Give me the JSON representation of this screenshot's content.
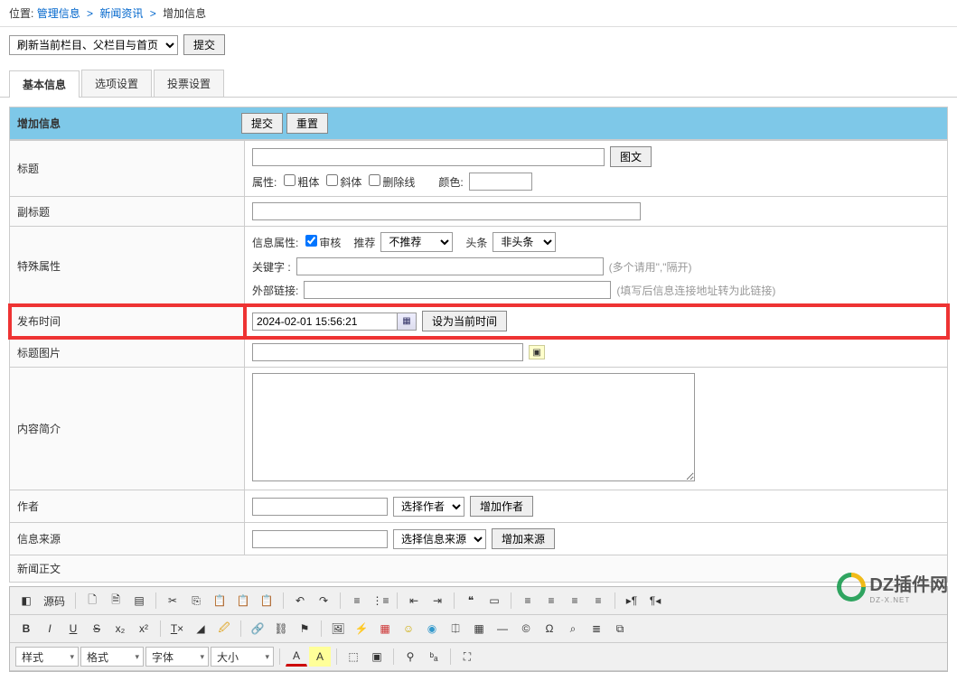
{
  "breadcrumb": {
    "label": "位置:",
    "items": [
      "管理信息",
      "新闻资讯",
      "增加信息"
    ]
  },
  "toolbar": {
    "refresh_select": "刷新当前栏目、父栏目与首页",
    "submit": "提交"
  },
  "tabs": [
    "基本信息",
    "选项设置",
    "投票设置"
  ],
  "panel": {
    "title": "增加信息",
    "submit": "提交",
    "reset": "重置"
  },
  "form": {
    "title": {
      "label": "标题",
      "imgtext_btn": "图文",
      "attr_label": "属性:",
      "bold": "粗体",
      "italic": "斜体",
      "strike": "删除线",
      "color_label": "颜色:"
    },
    "subtitle": {
      "label": "副标题"
    },
    "special": {
      "label": "特殊属性",
      "infoattr_label": "信息属性:",
      "audit": "审核",
      "recommend_label": "推荐",
      "recommend_select": "不推荐",
      "headline_label": "头条",
      "headline_select": "非头条",
      "keyword_label": "关键字 :",
      "keyword_hint": "(多个请用\",\"隔开)",
      "extlink_label": "外部链接:",
      "extlink_hint": "(填写后信息连接地址转为此链接)"
    },
    "pubtime": {
      "label": "发布时间",
      "value": "2024-02-01 15:56:21",
      "now_btn": "设为当前时间"
    },
    "titlepic": {
      "label": "标题图片"
    },
    "intro": {
      "label": "内容简介"
    },
    "author": {
      "label": "作者",
      "select": "选择作者",
      "add_btn": "增加作者"
    },
    "source": {
      "label": "信息来源",
      "select": "选择信息来源",
      "add_btn": "增加来源"
    },
    "body": {
      "label": "新闻正文"
    }
  },
  "editor": {
    "source": "源码",
    "row2": {
      "bold": "B",
      "italic": "I",
      "underline": "U",
      "strike": "S"
    },
    "selects": {
      "style": "样式",
      "format": "格式",
      "font": "字体",
      "size": "大小"
    },
    "color_a": "A"
  },
  "watermark": {
    "text": "DZ插件网",
    "sub": "DZ-X.NET"
  }
}
